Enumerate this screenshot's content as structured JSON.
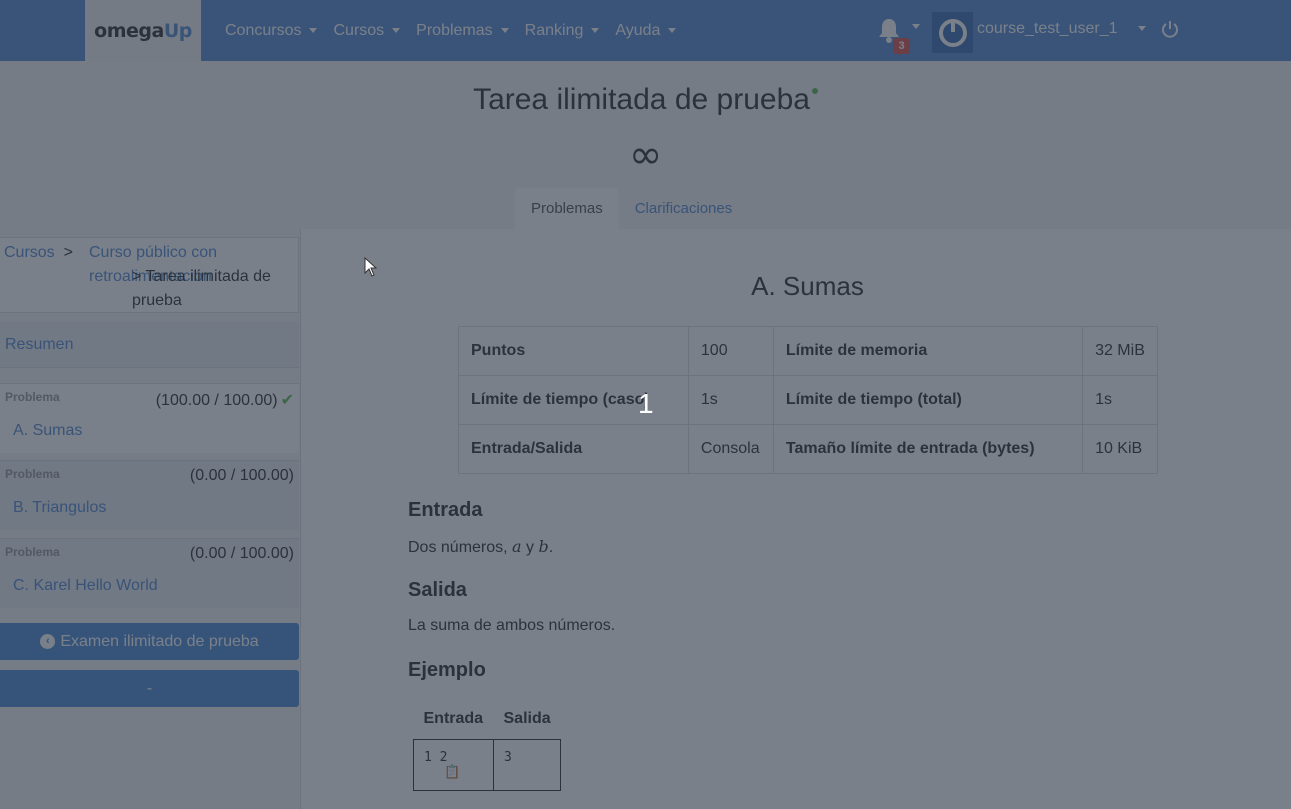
{
  "navbar": {
    "brand_omega": "omega",
    "brand_up": "Up",
    "menu": [
      {
        "label": "Concursos"
      },
      {
        "label": "Cursos"
      },
      {
        "label": "Problemas"
      },
      {
        "label": "Ranking"
      },
      {
        "label": "Ayuda"
      }
    ],
    "notification_count": "3",
    "username": "course_test_user_1"
  },
  "header": {
    "title": "Tarea ilimitada de prueba",
    "time_remaining": "∞",
    "tabs": [
      {
        "label": "Problemas",
        "active": true
      },
      {
        "label": "Clarificaciones",
        "active": false
      }
    ]
  },
  "sidebar": {
    "breadcrumb": {
      "courses": "Cursos",
      "course": "Curso público con retroalimentación",
      "current": "> Tarea ilimitada de prueba"
    },
    "summary_label": "Resumen",
    "problems": [
      {
        "tag": "Problema",
        "score": "(100.00 / 100.00)",
        "name": "A. Sumas",
        "solved": true
      },
      {
        "tag": "Problema",
        "score": "(0.00 / 100.00)",
        "name": "B. Triangulos",
        "solved": false
      },
      {
        "tag": "Problema",
        "score": "(0.00 / 100.00)",
        "name": "C. Karel Hello World",
        "solved": false
      }
    ],
    "back_button": "Examen ilimitado de prueba",
    "second_button": "-"
  },
  "problem": {
    "title": "A. Sumas",
    "info": [
      {
        "k1": "Puntos",
        "v1": "100",
        "k2": "Límite de memoria",
        "v2": "32 MiB"
      },
      {
        "k1": "Límite de tiempo (caso)",
        "v1": "1s",
        "k2": "Límite de tiempo (total)",
        "v2": "1s"
      },
      {
        "k1": "Entrada/Salida",
        "v1": "Consola",
        "k2": "Tamaño límite de entrada (bytes)",
        "v2": "10 KiB"
      }
    ],
    "input_heading": "Entrada",
    "input_text_prefix": "Dos números, ",
    "input_var_a": "a",
    "input_text_mid": " y ",
    "input_var_b": "b",
    "input_text_suffix": ".",
    "output_heading": "Salida",
    "output_text": "La suma de ambos números.",
    "example_heading": "Ejemplo",
    "example_headers": {
      "input": "Entrada",
      "output": "Salida"
    },
    "example_rows": [
      {
        "input": "1 2",
        "output": "3"
      }
    ]
  },
  "overlay": {
    "step_number": "1"
  },
  "colors": {
    "navbar": "#5588d4",
    "accent": "#5588d4",
    "success": "#5cb85c",
    "badge": "#d9534f"
  }
}
